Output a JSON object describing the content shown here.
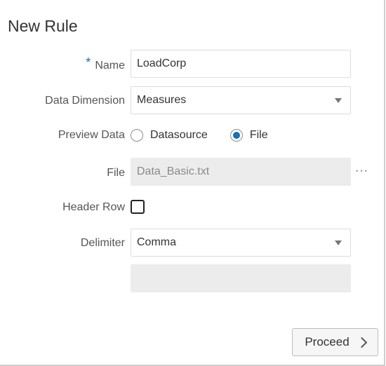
{
  "dialog": {
    "title": "New Rule"
  },
  "form": {
    "name": {
      "required_mark": "*",
      "label": "Name",
      "value": "LoadCorp"
    },
    "data_dimension": {
      "label": "Data Dimension",
      "value": "Measures"
    },
    "preview_data": {
      "label": "Preview Data",
      "options": [
        {
          "label": "Datasource",
          "selected": false
        },
        {
          "label": "File",
          "selected": true
        }
      ]
    },
    "file": {
      "label": "File",
      "value": "Data_Basic.txt",
      "browse_label": "···"
    },
    "header_row": {
      "label": "Header Row",
      "checked": false
    },
    "delimiter": {
      "label": "Delimiter",
      "value": "Comma"
    },
    "extra_field": {
      "value": ""
    }
  },
  "actions": {
    "proceed_label": "Proceed"
  },
  "colors": {
    "accent": "#1a6fb5",
    "readonly_bg": "#ececec"
  }
}
